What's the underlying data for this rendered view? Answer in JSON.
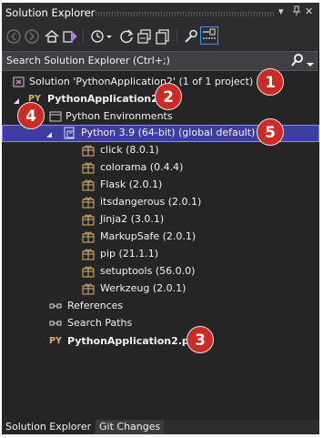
{
  "window": {
    "title": "Solution Explorer",
    "controls": [
      "▾",
      "ᵖ",
      "✕"
    ]
  },
  "search": {
    "placeholder": "Search Solution Explorer (Ctrl+;)"
  },
  "tree": {
    "solution": "Solution 'PythonApplication2' (1 of 1 project)",
    "project": "PythonApplication2",
    "environments": "Python Environments",
    "interpreter": "Python 3.9 (64-bit) (global default)",
    "packages": [
      "click (8.0.1)",
      "colorama (0.4.4)",
      "Flask (2.0.1)",
      "itsdangerous (2.0.1)",
      "Jinja2 (3.0.1)",
      "MarkupSafe (2.0.1)",
      "pip (21.1.1)",
      "setuptools (56.0.0)",
      "Werkzeug (2.0.1)"
    ],
    "references": "References",
    "search_paths": "Search Paths",
    "file_tag": "PY",
    "file": "PythonApplication2.py"
  },
  "callouts": [
    "1",
    "2",
    "3",
    "4",
    "5"
  ],
  "tabs": [
    "Solution Explorer",
    "Git Changes"
  ],
  "colors": {
    "background": "#252526",
    "selection": "#3e3e9e",
    "callout": "#cc2a24"
  }
}
